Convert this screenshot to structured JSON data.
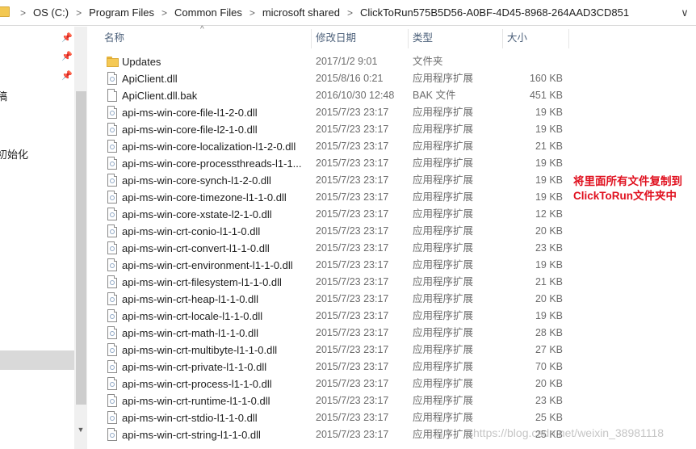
{
  "address_bar": {
    "crumbs": [
      "OS (C:)",
      "Program Files",
      "Common Files",
      "microsoft shared",
      "ClickToRun575B5D56-A0BF-4D45-8968-264AAD3CD851"
    ],
    "separator": ">",
    "dropdown_glyph": "∨",
    "icon": "folder-icon"
  },
  "nav_pane": {
    "fragments": [
      "稿",
      "初始化"
    ],
    "pin_icon": "pin-icon",
    "blue_fragment": ")"
  },
  "columns": {
    "name": "名称",
    "date": "修改日期",
    "type": "类型",
    "size": "大小",
    "sort_glyph": "^"
  },
  "files": [
    {
      "name": "Updates",
      "date": "2017/1/2 9:01",
      "type": "文件夹",
      "size": "",
      "icon": "folder-icon"
    },
    {
      "name": "ApiClient.dll",
      "date": "2015/8/16 0:21",
      "type": "应用程序扩展",
      "size": "160 KB",
      "icon": "dll-file-icon"
    },
    {
      "name": "ApiClient.dll.bak",
      "date": "2016/10/30 12:48",
      "type": "BAK 文件",
      "size": "451 KB",
      "icon": "blank-file-icon"
    },
    {
      "name": "api-ms-win-core-file-l1-2-0.dll",
      "date": "2015/7/23 23:17",
      "type": "应用程序扩展",
      "size": "19 KB",
      "icon": "dll-file-icon"
    },
    {
      "name": "api-ms-win-core-file-l2-1-0.dll",
      "date": "2015/7/23 23:17",
      "type": "应用程序扩展",
      "size": "19 KB",
      "icon": "dll-file-icon"
    },
    {
      "name": "api-ms-win-core-localization-l1-2-0.dll",
      "date": "2015/7/23 23:17",
      "type": "应用程序扩展",
      "size": "21 KB",
      "icon": "dll-file-icon"
    },
    {
      "name": "api-ms-win-core-processthreads-l1-1...",
      "date": "2015/7/23 23:17",
      "type": "应用程序扩展",
      "size": "19 KB",
      "icon": "dll-file-icon"
    },
    {
      "name": "api-ms-win-core-synch-l1-2-0.dll",
      "date": "2015/7/23 23:17",
      "type": "应用程序扩展",
      "size": "19 KB",
      "icon": "dll-file-icon"
    },
    {
      "name": "api-ms-win-core-timezone-l1-1-0.dll",
      "date": "2015/7/23 23:17",
      "type": "应用程序扩展",
      "size": "19 KB",
      "icon": "dll-file-icon"
    },
    {
      "name": "api-ms-win-core-xstate-l2-1-0.dll",
      "date": "2015/7/23 23:17",
      "type": "应用程序扩展",
      "size": "12 KB",
      "icon": "dll-file-icon"
    },
    {
      "name": "api-ms-win-crt-conio-l1-1-0.dll",
      "date": "2015/7/23 23:17",
      "type": "应用程序扩展",
      "size": "20 KB",
      "icon": "dll-file-icon"
    },
    {
      "name": "api-ms-win-crt-convert-l1-1-0.dll",
      "date": "2015/7/23 23:17",
      "type": "应用程序扩展",
      "size": "23 KB",
      "icon": "dll-file-icon"
    },
    {
      "name": "api-ms-win-crt-environment-l1-1-0.dll",
      "date": "2015/7/23 23:17",
      "type": "应用程序扩展",
      "size": "19 KB",
      "icon": "dll-file-icon"
    },
    {
      "name": "api-ms-win-crt-filesystem-l1-1-0.dll",
      "date": "2015/7/23 23:17",
      "type": "应用程序扩展",
      "size": "21 KB",
      "icon": "dll-file-icon"
    },
    {
      "name": "api-ms-win-crt-heap-l1-1-0.dll",
      "date": "2015/7/23 23:17",
      "type": "应用程序扩展",
      "size": "20 KB",
      "icon": "dll-file-icon"
    },
    {
      "name": "api-ms-win-crt-locale-l1-1-0.dll",
      "date": "2015/7/23 23:17",
      "type": "应用程序扩展",
      "size": "19 KB",
      "icon": "dll-file-icon"
    },
    {
      "name": "api-ms-win-crt-math-l1-1-0.dll",
      "date": "2015/7/23 23:17",
      "type": "应用程序扩展",
      "size": "28 KB",
      "icon": "dll-file-icon"
    },
    {
      "name": "api-ms-win-crt-multibyte-l1-1-0.dll",
      "date": "2015/7/23 23:17",
      "type": "应用程序扩展",
      "size": "27 KB",
      "icon": "dll-file-icon"
    },
    {
      "name": "api-ms-win-crt-private-l1-1-0.dll",
      "date": "2015/7/23 23:17",
      "type": "应用程序扩展",
      "size": "70 KB",
      "icon": "dll-file-icon"
    },
    {
      "name": "api-ms-win-crt-process-l1-1-0.dll",
      "date": "2015/7/23 23:17",
      "type": "应用程序扩展",
      "size": "20 KB",
      "icon": "dll-file-icon"
    },
    {
      "name": "api-ms-win-crt-runtime-l1-1-0.dll",
      "date": "2015/7/23 23:17",
      "type": "应用程序扩展",
      "size": "23 KB",
      "icon": "dll-file-icon"
    },
    {
      "name": "api-ms-win-crt-stdio-l1-1-0.dll",
      "date": "2015/7/23 23:17",
      "type": "应用程序扩展",
      "size": "25 KB",
      "icon": "dll-file-icon"
    },
    {
      "name": "api-ms-win-crt-string-l1-1-0.dll",
      "date": "2015/7/23 23:17",
      "type": "应用程序扩展",
      "size": "25 KB",
      "icon": "dll-file-icon"
    }
  ],
  "annotation": {
    "line1": "将里面所有文件复制到",
    "line2": "ClickToRun文件夹中",
    "color": "#e0101e"
  },
  "watermark": "https://blog.csdn.net/weixin_38981118"
}
